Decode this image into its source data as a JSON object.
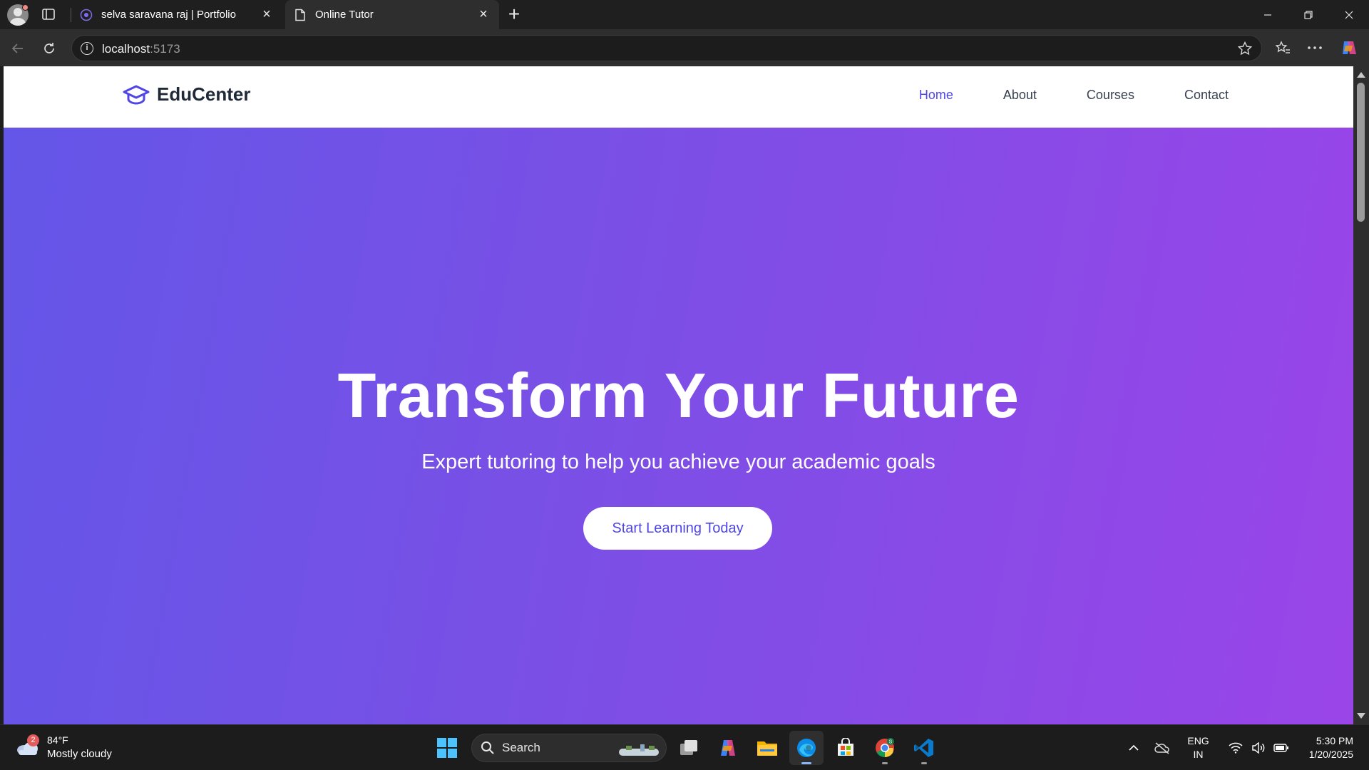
{
  "browser": {
    "tabs": [
      {
        "title": "selva saravana raj | Portfolio",
        "active": false
      },
      {
        "title": "Online Tutor",
        "active": true
      }
    ],
    "url_host": "localhost",
    "url_port": ":5173"
  },
  "site": {
    "brand": "EduCenter",
    "nav": [
      {
        "label": "Home",
        "active": true
      },
      {
        "label": "About",
        "active": false
      },
      {
        "label": "Courses",
        "active": false
      },
      {
        "label": "Contact",
        "active": false
      }
    ],
    "hero": {
      "title": "Transform Your Future",
      "subtitle": "Expert tutoring to help you achieve your academic goals",
      "cta": "Start Learning Today"
    },
    "colors": {
      "accent": "#4f46e5",
      "hero_gradient_start": "#6456e8",
      "hero_gradient_end": "#9a45e8"
    }
  },
  "taskbar": {
    "weather": {
      "badge": "2",
      "temp": "84°F",
      "condition": "Mostly cloudy"
    },
    "search_label": "Search",
    "apps": [
      "task-view",
      "copilot",
      "file-explorer",
      "edge",
      "microsoft-store",
      "chrome",
      "vscode"
    ],
    "language": {
      "line1": "ENG",
      "line2": "IN"
    },
    "clock": {
      "time": "5:30 PM",
      "date": "1/20/2025"
    }
  }
}
